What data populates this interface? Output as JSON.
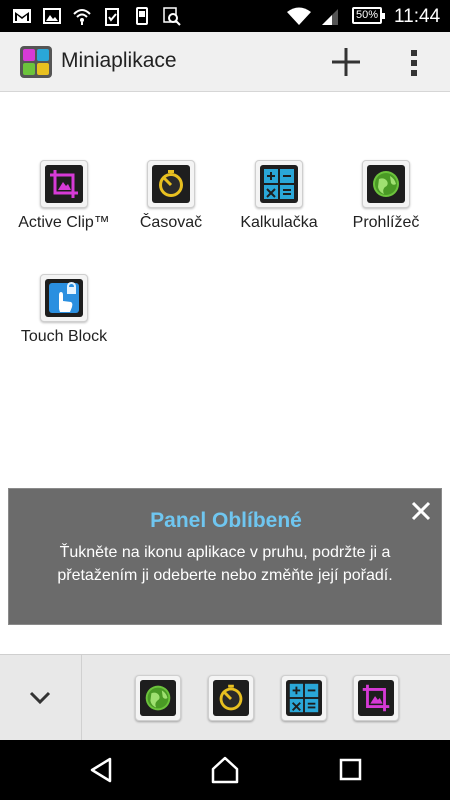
{
  "status_bar": {
    "time": "11:44",
    "battery": "50%",
    "icons": [
      "gmail-icon",
      "image-icon",
      "wifi-download-icon",
      "clipboard-check-icon",
      "phone-icon",
      "search-icon",
      "wifi-icon",
      "signal-icon"
    ]
  },
  "action_bar": {
    "title": "Miniaplikace",
    "icons": [
      "app-logo-icon",
      "plus-icon",
      "overflow-menu-icon"
    ]
  },
  "apps": [
    {
      "label": "Active Clip™",
      "icon": "crop-icon",
      "color": "#d63ad6"
    },
    {
      "label": "Časovač",
      "icon": "timer-icon",
      "color": "#e8c020"
    },
    {
      "label": "Kalkulačka",
      "icon": "calculator-icon",
      "color": "#2aa7d8"
    },
    {
      "label": "Prohlížeč",
      "icon": "globe-icon",
      "color": "#6cc33c"
    },
    {
      "label": "Touch Block",
      "icon": "touch-block-icon",
      "color": "#2a8fe0"
    }
  ],
  "panel": {
    "title": "Panel Oblíbené",
    "text": "Ťukněte na ikonu aplikace v pruhu, podržte ji a přetažením ji odeberte nebo změňte její pořadí."
  },
  "favorites": {
    "items": [
      "globe-icon",
      "timer-icon",
      "calculator-icon",
      "crop-icon"
    ]
  },
  "nav_bar": {
    "icons": [
      "back-icon",
      "home-icon",
      "recents-icon"
    ]
  },
  "colors": {
    "panel_title": "#6fc6f0",
    "panel_bg": "#6b6b6b"
  }
}
